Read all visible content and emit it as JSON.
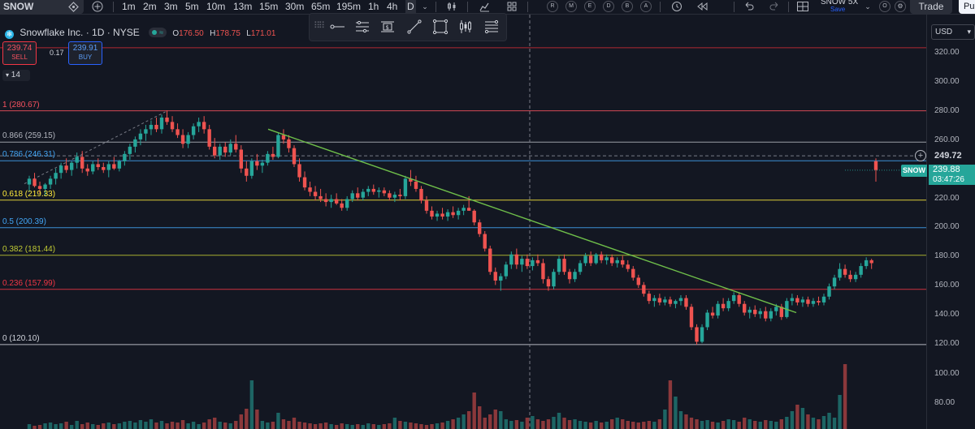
{
  "toolbar": {
    "symbol": "SNOW",
    "timeframes": [
      "1m",
      "2m",
      "3m",
      "5m",
      "10m",
      "13m",
      "15m",
      "30m",
      "65m",
      "195m",
      "1h",
      "4h",
      "D"
    ],
    "active_timeframe": "D",
    "circle_buttons": [
      "R",
      "M",
      "E",
      "D",
      "B",
      "A"
    ],
    "layout_name": "SNOW 5X",
    "layout_save": "Save",
    "trade_label": "Trade",
    "publish_label": "Pu"
  },
  "legend": {
    "logo_glyph": "❄",
    "title": "Snowflake Inc. · 1D · NYSE",
    "pill_glyph": "≈",
    "open_key": "O",
    "open": "176.50",
    "high_key": "H",
    "high": "178.75",
    "low_key": "L",
    "low": "171.01",
    "sell_price": "239.74",
    "sell_label": "SELL",
    "spread": "0.17",
    "buy_price": "239.91",
    "buy_label": "BUY",
    "indicator_count": "14"
  },
  "axis": {
    "currency": "USD",
    "price_ticks": [
      "320.00",
      "300.00",
      "280.00",
      "260.00",
      "240.00",
      "220.00",
      "200.00",
      "180.00",
      "160.00",
      "140.00",
      "120.00"
    ],
    "volume_ticks": [
      "100.00",
      "80.00"
    ],
    "crosshair_price": "249.72",
    "symbol_tag": "SNOW",
    "last_price": "239.88",
    "countdown": "03:47:26"
  },
  "fib_levels": [
    {
      "label": "1 (280.67)",
      "price": 280.67,
      "color": "#f7525f"
    },
    {
      "label": "0.866 (259.15)",
      "price": 259.15,
      "color": "#b2b5be"
    },
    {
      "label": "0.786 (246.31)",
      "price": 246.31,
      "color": "#42a5f5"
    },
    {
      "label": "0.618 (219.33)",
      "price": 219.33,
      "color": "#ffeb3b"
    },
    {
      "label": "0.5 (200.39)",
      "price": 200.39,
      "color": "#42a5f5"
    },
    {
      "label": "0.382 (181.44)",
      "price": 181.44,
      "color": "#c0ca33"
    },
    {
      "label": "0.236 (157.99)",
      "price": 157.99,
      "color": "#f23645"
    },
    {
      "label": "0 (120.10)",
      "price": 120.1,
      "color": "#d1d4dc"
    }
  ],
  "colors": {
    "background": "#131722",
    "up": "#26a69a",
    "down": "#ef5350",
    "trendline": "#6fbf4a",
    "alert_line": "#b22833"
  },
  "chart_data": {
    "type": "candlestick",
    "alert_price": 324,
    "crosshair_price": 249.72,
    "last_price": 239.88,
    "trendline": [
      {
        "price": 268
      },
      {
        "price": 142
      }
    ],
    "candles": [
      {
        "o": 230,
        "h": 236,
        "l": 225,
        "c": 234
      },
      {
        "o": 234,
        "h": 238,
        "l": 228,
        "c": 229
      },
      {
        "o": 229,
        "h": 232,
        "l": 224,
        "c": 227
      },
      {
        "o": 227,
        "h": 231,
        "l": 222,
        "c": 230
      },
      {
        "o": 230,
        "h": 236,
        "l": 227,
        "c": 234
      },
      {
        "o": 234,
        "h": 241,
        "l": 230,
        "c": 238
      },
      {
        "o": 238,
        "h": 245,
        "l": 234,
        "c": 243
      },
      {
        "o": 243,
        "h": 248,
        "l": 238,
        "c": 240
      },
      {
        "o": 240,
        "h": 246,
        "l": 236,
        "c": 245
      },
      {
        "o": 245,
        "h": 252,
        "l": 241,
        "c": 249
      },
      {
        "o": 249,
        "h": 253,
        "l": 238,
        "c": 241
      },
      {
        "o": 241,
        "h": 244,
        "l": 236,
        "c": 239
      },
      {
        "o": 239,
        "h": 246,
        "l": 237,
        "c": 244
      },
      {
        "o": 244,
        "h": 248,
        "l": 240,
        "c": 242
      },
      {
        "o": 242,
        "h": 245,
        "l": 238,
        "c": 240
      },
      {
        "o": 240,
        "h": 246,
        "l": 235,
        "c": 244
      },
      {
        "o": 244,
        "h": 249,
        "l": 240,
        "c": 241
      },
      {
        "o": 241,
        "h": 247,
        "l": 239,
        "c": 246
      },
      {
        "o": 246,
        "h": 253,
        "l": 243,
        "c": 251
      },
      {
        "o": 251,
        "h": 258,
        "l": 247,
        "c": 256
      },
      {
        "o": 256,
        "h": 263,
        "l": 252,
        "c": 261
      },
      {
        "o": 261,
        "h": 268,
        "l": 257,
        "c": 265
      },
      {
        "o": 265,
        "h": 271,
        "l": 260,
        "c": 268
      },
      {
        "o": 268,
        "h": 274,
        "l": 264,
        "c": 271
      },
      {
        "o": 271,
        "h": 276,
        "l": 266,
        "c": 268
      },
      {
        "o": 268,
        "h": 278,
        "l": 265,
        "c": 276
      },
      {
        "o": 276,
        "h": 281,
        "l": 271,
        "c": 273
      },
      {
        "o": 273,
        "h": 277,
        "l": 266,
        "c": 268
      },
      {
        "o": 268,
        "h": 272,
        "l": 262,
        "c": 264
      },
      {
        "o": 264,
        "h": 268,
        "l": 255,
        "c": 258
      },
      {
        "o": 258,
        "h": 266,
        "l": 255,
        "c": 264
      },
      {
        "o": 264,
        "h": 272,
        "l": 261,
        "c": 270
      },
      {
        "o": 270,
        "h": 276,
        "l": 266,
        "c": 273
      },
      {
        "o": 273,
        "h": 277,
        "l": 265,
        "c": 268
      },
      {
        "o": 268,
        "h": 271,
        "l": 254,
        "c": 256
      },
      {
        "o": 256,
        "h": 262,
        "l": 248,
        "c": 250
      },
      {
        "o": 250,
        "h": 258,
        "l": 247,
        "c": 256
      },
      {
        "o": 256,
        "h": 259,
        "l": 249,
        "c": 252
      },
      {
        "o": 252,
        "h": 261,
        "l": 250,
        "c": 258
      },
      {
        "o": 258,
        "h": 264,
        "l": 252,
        "c": 254
      },
      {
        "o": 254,
        "h": 257,
        "l": 238,
        "c": 241
      },
      {
        "o": 241,
        "h": 246,
        "l": 232,
        "c": 236
      },
      {
        "o": 236,
        "h": 248,
        "l": 234,
        "c": 246
      },
      {
        "o": 246,
        "h": 251,
        "l": 240,
        "c": 243
      },
      {
        "o": 243,
        "h": 247,
        "l": 238,
        "c": 245
      },
      {
        "o": 245,
        "h": 253,
        "l": 243,
        "c": 251
      },
      {
        "o": 251,
        "h": 256,
        "l": 247,
        "c": 249
      },
      {
        "o": 249,
        "h": 266,
        "l": 248,
        "c": 264
      },
      {
        "o": 264,
        "h": 268,
        "l": 258,
        "c": 261
      },
      {
        "o": 261,
        "h": 264,
        "l": 252,
        "c": 255
      },
      {
        "o": 255,
        "h": 257,
        "l": 242,
        "c": 244
      },
      {
        "o": 244,
        "h": 248,
        "l": 232,
        "c": 235
      },
      {
        "o": 235,
        "h": 239,
        "l": 226,
        "c": 228
      },
      {
        "o": 228,
        "h": 232,
        "l": 222,
        "c": 225
      },
      {
        "o": 225,
        "h": 229,
        "l": 219,
        "c": 222
      },
      {
        "o": 222,
        "h": 227,
        "l": 218,
        "c": 220
      },
      {
        "o": 220,
        "h": 224,
        "l": 215,
        "c": 218
      },
      {
        "o": 218,
        "h": 223,
        "l": 214,
        "c": 220
      },
      {
        "o": 220,
        "h": 224,
        "l": 216,
        "c": 217
      },
      {
        "o": 217,
        "h": 220,
        "l": 212,
        "c": 214
      },
      {
        "o": 214,
        "h": 222,
        "l": 212,
        "c": 220
      },
      {
        "o": 220,
        "h": 226,
        "l": 218,
        "c": 224
      },
      {
        "o": 224,
        "h": 228,
        "l": 219,
        "c": 221
      },
      {
        "o": 221,
        "h": 227,
        "l": 219,
        "c": 225
      },
      {
        "o": 225,
        "h": 229,
        "l": 222,
        "c": 227
      },
      {
        "o": 227,
        "h": 230,
        "l": 223,
        "c": 225
      },
      {
        "o": 225,
        "h": 228,
        "l": 221,
        "c": 226
      },
      {
        "o": 226,
        "h": 228,
        "l": 222,
        "c": 224
      },
      {
        "o": 224,
        "h": 226,
        "l": 219,
        "c": 221
      },
      {
        "o": 221,
        "h": 225,
        "l": 218,
        "c": 223
      },
      {
        "o": 223,
        "h": 227,
        "l": 219,
        "c": 222
      },
      {
        "o": 222,
        "h": 236,
        "l": 220,
        "c": 234
      },
      {
        "o": 234,
        "h": 240,
        "l": 229,
        "c": 232
      },
      {
        "o": 232,
        "h": 236,
        "l": 225,
        "c": 227
      },
      {
        "o": 227,
        "h": 229,
        "l": 217,
        "c": 219
      },
      {
        "o": 219,
        "h": 222,
        "l": 210,
        "c": 212
      },
      {
        "o": 212,
        "h": 215,
        "l": 206,
        "c": 208
      },
      {
        "o": 208,
        "h": 212,
        "l": 205,
        "c": 210
      },
      {
        "o": 210,
        "h": 214,
        "l": 206,
        "c": 208
      },
      {
        "o": 208,
        "h": 213,
        "l": 205,
        "c": 211
      },
      {
        "o": 211,
        "h": 215,
        "l": 207,
        "c": 209
      },
      {
        "o": 209,
        "h": 214,
        "l": 206,
        "c": 212
      },
      {
        "o": 212,
        "h": 216,
        "l": 209,
        "c": 214
      },
      {
        "o": 214,
        "h": 222,
        "l": 212,
        "c": 212
      },
      {
        "o": 212,
        "h": 213,
        "l": 202,
        "c": 204
      },
      {
        "o": 204,
        "h": 206,
        "l": 194,
        "c": 196
      },
      {
        "o": 196,
        "h": 198,
        "l": 184,
        "c": 186
      },
      {
        "o": 186,
        "h": 188,
        "l": 168,
        "c": 170
      },
      {
        "o": 170,
        "h": 173,
        "l": 161,
        "c": 164
      },
      {
        "o": 164,
        "h": 169,
        "l": 157,
        "c": 167
      },
      {
        "o": 167,
        "h": 177,
        "l": 165,
        "c": 175
      },
      {
        "o": 175,
        "h": 184,
        "l": 172,
        "c": 182
      },
      {
        "o": 182,
        "h": 186,
        "l": 172,
        "c": 175
      },
      {
        "o": 175,
        "h": 181,
        "l": 170,
        "c": 179
      },
      {
        "o": 179,
        "h": 182,
        "l": 172,
        "c": 174
      },
      {
        "o": 174,
        "h": 180,
        "l": 171,
        "c": 178
      },
      {
        "o": 178,
        "h": 182,
        "l": 174,
        "c": 176
      },
      {
        "o": 176,
        "h": 179,
        "l": 162,
        "c": 165
      },
      {
        "o": 165,
        "h": 167,
        "l": 157,
        "c": 160
      },
      {
        "o": 160,
        "h": 172,
        "l": 158,
        "c": 170
      },
      {
        "o": 170,
        "h": 181,
        "l": 168,
        "c": 179
      },
      {
        "o": 179,
        "h": 182,
        "l": 168,
        "c": 170
      },
      {
        "o": 170,
        "h": 172,
        "l": 162,
        "c": 165
      },
      {
        "o": 165,
        "h": 172,
        "l": 163,
        "c": 170
      },
      {
        "o": 170,
        "h": 178,
        "l": 168,
        "c": 176
      },
      {
        "o": 176,
        "h": 183,
        "l": 174,
        "c": 181
      },
      {
        "o": 181,
        "h": 184,
        "l": 174,
        "c": 176
      },
      {
        "o": 176,
        "h": 183,
        "l": 175,
        "c": 182
      },
      {
        "o": 182,
        "h": 184,
        "l": 176,
        "c": 178
      },
      {
        "o": 178,
        "h": 182,
        "l": 175,
        "c": 180
      },
      {
        "o": 180,
        "h": 182,
        "l": 174,
        "c": 176
      },
      {
        "o": 176,
        "h": 180,
        "l": 173,
        "c": 178
      },
      {
        "o": 178,
        "h": 181,
        "l": 173,
        "c": 175
      },
      {
        "o": 175,
        "h": 178,
        "l": 170,
        "c": 172
      },
      {
        "o": 172,
        "h": 174,
        "l": 164,
        "c": 166
      },
      {
        "o": 166,
        "h": 168,
        "l": 159,
        "c": 161
      },
      {
        "o": 161,
        "h": 163,
        "l": 153,
        "c": 155
      },
      {
        "o": 155,
        "h": 157,
        "l": 148,
        "c": 150
      },
      {
        "o": 150,
        "h": 154,
        "l": 146,
        "c": 152
      },
      {
        "o": 152,
        "h": 155,
        "l": 147,
        "c": 149
      },
      {
        "o": 149,
        "h": 153,
        "l": 147,
        "c": 151
      },
      {
        "o": 151,
        "h": 153,
        "l": 146,
        "c": 148
      },
      {
        "o": 148,
        "h": 151,
        "l": 145,
        "c": 150
      },
      {
        "o": 150,
        "h": 154,
        "l": 147,
        "c": 152
      },
      {
        "o": 152,
        "h": 154,
        "l": 144,
        "c": 146
      },
      {
        "o": 146,
        "h": 148,
        "l": 130,
        "c": 132
      },
      {
        "o": 132,
        "h": 134,
        "l": 120,
        "c": 122
      },
      {
        "o": 122,
        "h": 134,
        "l": 121,
        "c": 132
      },
      {
        "o": 132,
        "h": 144,
        "l": 130,
        "c": 142
      },
      {
        "o": 142,
        "h": 146,
        "l": 138,
        "c": 140
      },
      {
        "o": 140,
        "h": 150,
        "l": 138,
        "c": 148
      },
      {
        "o": 148,
        "h": 152,
        "l": 143,
        "c": 145
      },
      {
        "o": 145,
        "h": 152,
        "l": 143,
        "c": 150
      },
      {
        "o": 150,
        "h": 156,
        "l": 148,
        "c": 154
      },
      {
        "o": 154,
        "h": 156,
        "l": 146,
        "c": 148
      },
      {
        "o": 148,
        "h": 150,
        "l": 140,
        "c": 142
      },
      {
        "o": 142,
        "h": 146,
        "l": 138,
        "c": 144
      },
      {
        "o": 144,
        "h": 147,
        "l": 139,
        "c": 141
      },
      {
        "o": 141,
        "h": 145,
        "l": 138,
        "c": 143
      },
      {
        "o": 143,
        "h": 146,
        "l": 136,
        "c": 138
      },
      {
        "o": 138,
        "h": 145,
        "l": 136,
        "c": 143
      },
      {
        "o": 143,
        "h": 148,
        "l": 140,
        "c": 146
      },
      {
        "o": 146,
        "h": 148,
        "l": 137,
        "c": 139
      },
      {
        "o": 139,
        "h": 152,
        "l": 138,
        "c": 150
      },
      {
        "o": 150,
        "h": 155,
        "l": 147,
        "c": 152
      },
      {
        "o": 152,
        "h": 154,
        "l": 147,
        "c": 149
      },
      {
        "o": 149,
        "h": 153,
        "l": 146,
        "c": 151
      },
      {
        "o": 151,
        "h": 153,
        "l": 146,
        "c": 148
      },
      {
        "o": 148,
        "h": 152,
        "l": 146,
        "c": 150
      },
      {
        "o": 150,
        "h": 153,
        "l": 147,
        "c": 149
      },
      {
        "o": 149,
        "h": 155,
        "l": 147,
        "c": 153
      },
      {
        "o": 153,
        "h": 162,
        "l": 151,
        "c": 160
      },
      {
        "o": 160,
        "h": 168,
        "l": 158,
        "c": 166
      },
      {
        "o": 166,
        "h": 176,
        "l": 164,
        "c": 172
      },
      {
        "o": 172,
        "h": 175,
        "l": 166,
        "c": 168
      },
      {
        "o": 168,
        "h": 171,
        "l": 163,
        "c": 165
      },
      {
        "o": 165,
        "h": 170,
        "l": 163,
        "c": 168
      },
      {
        "o": 168,
        "h": 176,
        "l": 166,
        "c": 174
      },
      {
        "o": 174,
        "h": 180,
        "l": 172,
        "c": 178
      },
      {
        "o": 178,
        "h": 179,
        "l": 172,
        "c": 176
      },
      {
        "o": 246,
        "h": 248,
        "l": 232,
        "c": 240
      }
    ],
    "volume": [
      6,
      4,
      5,
      7,
      8,
      6,
      7,
      9,
      5,
      10,
      6,
      8,
      6,
      5,
      7,
      8,
      6,
      7,
      9,
      10,
      8,
      11,
      9,
      12,
      8,
      10,
      7,
      9,
      8,
      11,
      7,
      9,
      6,
      8,
      12,
      14,
      9,
      8,
      7,
      10,
      18,
      25,
      60,
      24,
      10,
      8,
      9,
      20,
      12,
      10,
      14,
      9,
      8,
      7,
      6,
      7,
      8,
      6,
      5,
      7,
      6,
      5,
      6,
      5,
      7,
      6,
      5,
      6,
      7,
      14,
      10,
      9,
      8,
      7,
      6,
      5,
      6,
      7,
      8,
      10,
      12,
      14,
      18,
      22,
      45,
      28,
      14,
      18,
      24,
      22,
      12,
      10,
      11,
      9,
      14,
      16,
      12,
      10,
      12,
      15,
      20,
      14,
      11,
      12,
      10,
      9,
      8,
      10,
      8,
      9,
      12,
      14,
      12,
      10,
      9,
      8,
      9,
      10,
      9,
      12,
      24,
      60,
      40,
      22,
      18,
      14,
      12,
      10,
      11,
      9,
      8,
      10,
      12,
      11,
      9,
      14,
      12,
      10,
      9,
      11,
      10,
      9,
      12,
      15,
      22,
      30,
      26,
      18,
      14,
      12,
      16,
      20,
      14,
      42,
      80
    ]
  }
}
